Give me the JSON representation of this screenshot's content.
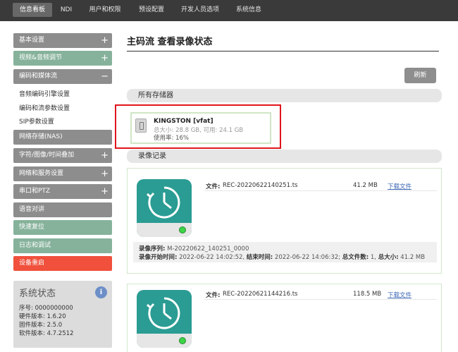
{
  "nav": {
    "tabs": [
      {
        "label": "信息看板",
        "active": true
      },
      {
        "label": "NDI"
      },
      {
        "label": "用户和权限"
      },
      {
        "label": "预设配置"
      },
      {
        "label": "开发人员选项"
      },
      {
        "label": "系统信息"
      }
    ]
  },
  "sidebar": {
    "items": [
      {
        "label": "基本设置",
        "sign": "+"
      },
      {
        "label": "视频&音频调节",
        "sign": "+"
      },
      {
        "label": "编码和媒体流",
        "sign": "−"
      },
      {
        "label": "网络存储(NAS)"
      },
      {
        "label": "字符/图像/时间叠加",
        "sign": "+"
      },
      {
        "label": "网络和服务设置",
        "sign": "+"
      },
      {
        "label": "串口和PTZ",
        "sign": "+"
      },
      {
        "label": "语音对讲"
      },
      {
        "label": "快速复位"
      },
      {
        "label": "日志和调试"
      },
      {
        "label": "设备重启"
      }
    ],
    "subitems": [
      "音频编码引擎设置",
      "编码和流参数设置",
      "SIP参数设置"
    ]
  },
  "status": {
    "title": "系统状态",
    "serial": "序号: 0000000000",
    "hardware": "硬件版本: 1.6.20",
    "firmware": "固件版本: 2.5.0",
    "software": "软件版本: 4.7.2512"
  },
  "main": {
    "title": "主码流 查看录像状态",
    "refresh": "刷新",
    "storage_header": "所有存储器",
    "records_header": "录像记录"
  },
  "storage": {
    "name": "KINGSTON [vfat]",
    "size": "总大小: 28.8 GB, 可用: 24.1 GB",
    "usage": "使用率: 16%"
  },
  "recordings": [
    {
      "file_label": "文件:",
      "file": "REC-20220622140251.ts",
      "size": "41.2 MB",
      "download": "下载文件",
      "seq_label": "录像序列:",
      "seq": "M-20220622_140251_0000",
      "start_label": "录像开始时间:",
      "start": "2022-06-22 14:02:52,",
      "end_label": "结束时间:",
      "end": "2022-06-22 14:06:32;",
      "count_label": "总文件数:",
      "count": "1,",
      "total_label": "总大小:",
      "total": "41.2 MB"
    },
    {
      "file_label": "文件:",
      "file": "REC-20220621144216.ts",
      "size": "118.5 MB",
      "download": "下载文件"
    }
  ],
  "colors": {
    "nav_bg": "#3a3a3a",
    "sidebar_gray": "#8d8d8d",
    "sidebar_green": "#86b29b",
    "sidebar_red": "#f0503c",
    "accent_teal": "#2a9c93",
    "highlight_red": "#e0151c",
    "link_blue": "#3a66b4"
  },
  "icons": [
    "usb-drive-icon",
    "clock-history-icon",
    "status-led-icon",
    "info-icon",
    "plus-icon",
    "minus-icon"
  ]
}
